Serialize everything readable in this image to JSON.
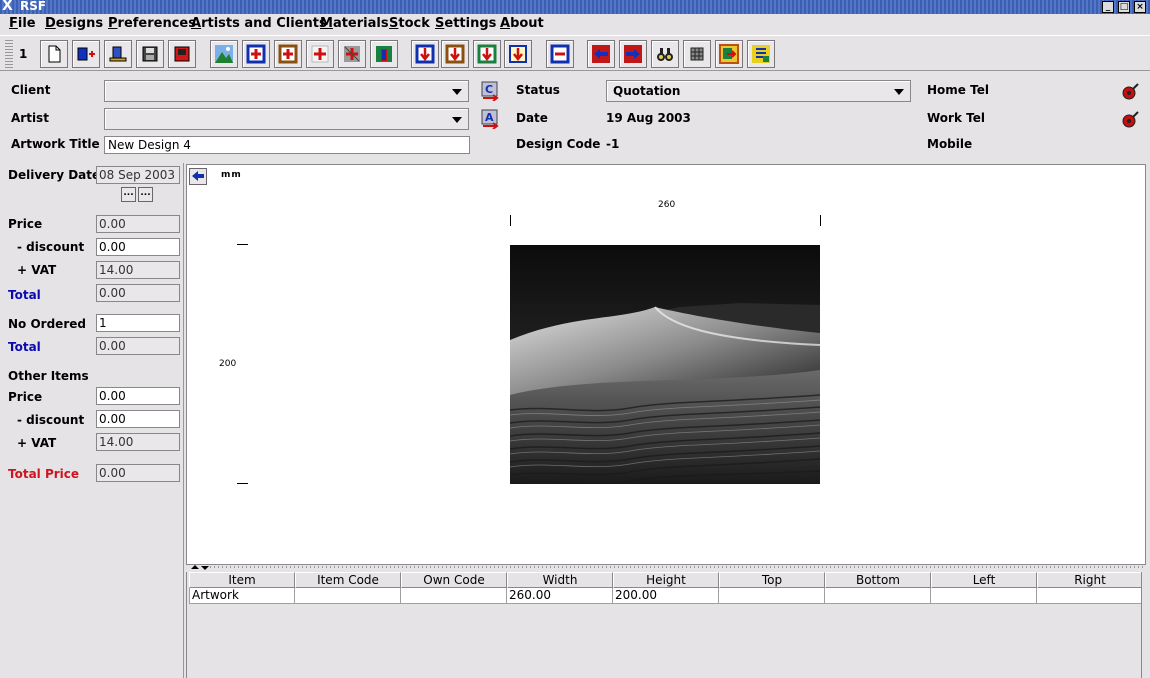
{
  "window": {
    "title": "RSF",
    "logo": "X"
  },
  "menu": [
    {
      "mnemonic": "F",
      "rest": "ile"
    },
    {
      "mnemonic": "D",
      "rest": "esigns"
    },
    {
      "mnemonic": "P",
      "rest": "references"
    },
    {
      "mnemonic": "A",
      "rest": "rtists and Clients"
    },
    {
      "mnemonic": "M",
      "rest": "aterials"
    },
    {
      "mnemonic": "S",
      "rest": "tock"
    },
    {
      "mnemonic": "S",
      "rest": "ettings"
    },
    {
      "mnemonic": "A",
      "rest": "bout"
    }
  ],
  "toolbar": {
    "number": "1",
    "icons": [
      "new-document-icon",
      "add-design-icon",
      "add-item-icon",
      "save-icon",
      "print-icon",
      "picture-icon",
      "add-mount-icon",
      "add-frame-icon",
      "add-glass-icon",
      "add-backing-icon",
      "add-extra-icon",
      "move-down-icon",
      "move-down-alt-icon",
      "move-down-green-icon",
      "move-down-yellow-icon",
      "remove-icon",
      "previous-icon",
      "next-icon",
      "find-icon",
      "stock-icon",
      "export-icon",
      "report-icon"
    ]
  },
  "header": {
    "client_label": "Client",
    "client_value": "",
    "artist_label": "Artist",
    "artist_value": "",
    "title_label": "Artwork Title",
    "title_value": "New Design 4",
    "status_label": "Status",
    "status_value": "Quotation",
    "date_label": "Date",
    "date_value": "19 Aug 2003",
    "design_code_label": "Design Code",
    "design_code_value": "-1",
    "home_tel_label": "Home Tel",
    "work_tel_label": "Work Tel",
    "mobile_label": "Mobile"
  },
  "left": {
    "delivery_label": "Delivery Date",
    "delivery_value": "08 Sep 2003",
    "btn1": "...",
    "btn2": "...",
    "price_label": "Price",
    "price_value": "0.00",
    "discount_label": "- discount",
    "discount_value": "0.00",
    "vat_label": "+ VAT",
    "vat_value": "14.00",
    "total_label": "Total",
    "total_value": "0.00",
    "ordered_label": "No Ordered",
    "ordered_value": "1",
    "total2_label": "Total",
    "total2_value": "0.00",
    "other_label": "Other Items",
    "oprice_label": "Price",
    "oprice_value": "0.00",
    "odiscount_label": "- discount",
    "odiscount_value": "0.00",
    "ovat_label": "+ VAT",
    "ovat_value": "14.00",
    "total_price_label": "Total Price",
    "total_price_value": "0.00"
  },
  "canvas": {
    "unit": "mm",
    "width_label": "260",
    "height_label": "200"
  },
  "table": {
    "columns": [
      "Item",
      "Item Code",
      "Own Code",
      "Width",
      "Height",
      "Top",
      "Bottom",
      "Left",
      "Right"
    ],
    "rows": [
      [
        "Artwork",
        "",
        "",
        "260.00",
        "200.00",
        "",
        "",
        "",
        ""
      ]
    ]
  },
  "colors": {
    "accent_blue": "#0a0ab0",
    "accent_red": "#d0141e",
    "title_bar": "#4a6cc0"
  }
}
